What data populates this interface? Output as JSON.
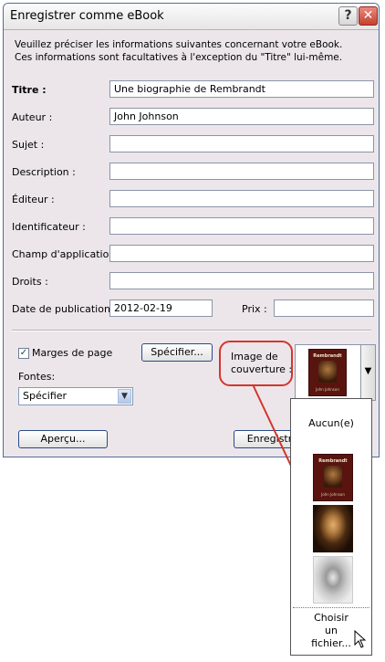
{
  "window": {
    "title": "Enregistrer comme eBook",
    "help_glyph": "?",
    "close_glyph": "✕"
  },
  "intro": {
    "line1": "Veuillez préciser les informations suivantes concernant votre eBook.",
    "line2": "Ces informations sont facultatives à l'exception du \"Titre\" lui-même."
  },
  "fields": {
    "title": {
      "label": "Titre :",
      "value": "Une biographie de Rembrandt"
    },
    "author": {
      "label": "Auteur :",
      "value": "John Johnson"
    },
    "subject": {
      "label": "Sujet :",
      "value": ""
    },
    "description": {
      "label": "Description :",
      "value": ""
    },
    "publisher": {
      "label": "Éditeur :",
      "value": ""
    },
    "identifier": {
      "label": "Identificateur :",
      "value": ""
    },
    "scope": {
      "label": "Champ d'application :",
      "value": ""
    },
    "rights": {
      "label": "Droits :",
      "value": ""
    },
    "pub_date": {
      "label": "Date de publication :",
      "value": "2012-02-19"
    },
    "price": {
      "label": "Prix :",
      "value": ""
    }
  },
  "options": {
    "margins_label": "Marges de page",
    "margins_checked": true,
    "specify_button": "Spécifier...",
    "fonts_label": "Fontes:",
    "fonts_value": "Spécifier",
    "cover_label_line1": "Image de",
    "cover_label_line2": "couverture :"
  },
  "book": {
    "title": "Rembrandt",
    "author": "John Johnson"
  },
  "buttons": {
    "preview": "Aperçu...",
    "save": "Enregistrer"
  },
  "cover_dropdown": {
    "none_label": "Aucun(e)",
    "choose_line1": "Choisir",
    "choose_line2": "un",
    "choose_line3": "fichier..."
  },
  "colors": {
    "callout": "#d4362a",
    "dialog_bg": "#ece6ea",
    "cover_red": "#5a1410"
  }
}
